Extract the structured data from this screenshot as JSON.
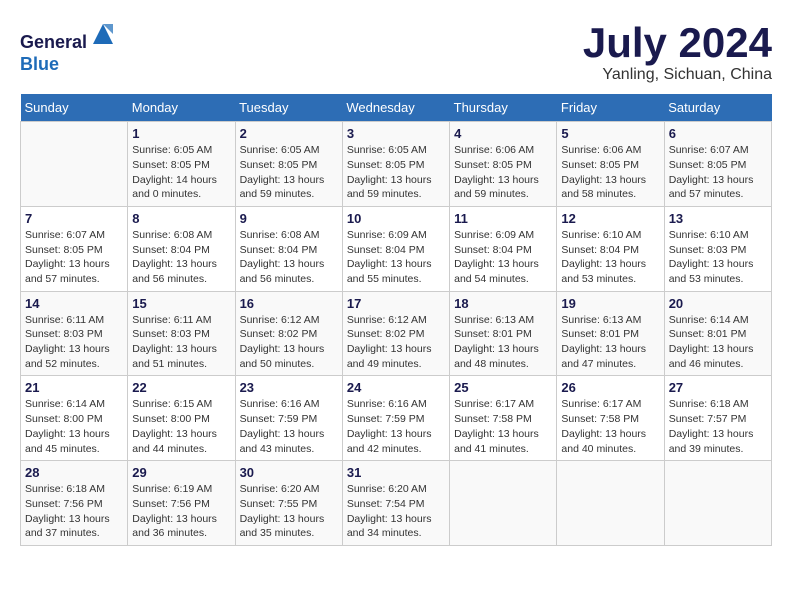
{
  "header": {
    "logo_line1": "General",
    "logo_line2": "Blue",
    "title": "July 2024",
    "location": "Yanling, Sichuan, China"
  },
  "calendar": {
    "weekdays": [
      "Sunday",
      "Monday",
      "Tuesday",
      "Wednesday",
      "Thursday",
      "Friday",
      "Saturday"
    ],
    "weeks": [
      [
        {
          "day": "",
          "info": ""
        },
        {
          "day": "1",
          "info": "Sunrise: 6:05 AM\nSunset: 8:05 PM\nDaylight: 14 hours\nand 0 minutes."
        },
        {
          "day": "2",
          "info": "Sunrise: 6:05 AM\nSunset: 8:05 PM\nDaylight: 13 hours\nand 59 minutes."
        },
        {
          "day": "3",
          "info": "Sunrise: 6:05 AM\nSunset: 8:05 PM\nDaylight: 13 hours\nand 59 minutes."
        },
        {
          "day": "4",
          "info": "Sunrise: 6:06 AM\nSunset: 8:05 PM\nDaylight: 13 hours\nand 59 minutes."
        },
        {
          "day": "5",
          "info": "Sunrise: 6:06 AM\nSunset: 8:05 PM\nDaylight: 13 hours\nand 58 minutes."
        },
        {
          "day": "6",
          "info": "Sunrise: 6:07 AM\nSunset: 8:05 PM\nDaylight: 13 hours\nand 57 minutes."
        }
      ],
      [
        {
          "day": "7",
          "info": "Sunrise: 6:07 AM\nSunset: 8:05 PM\nDaylight: 13 hours\nand 57 minutes."
        },
        {
          "day": "8",
          "info": "Sunrise: 6:08 AM\nSunset: 8:04 PM\nDaylight: 13 hours\nand 56 minutes."
        },
        {
          "day": "9",
          "info": "Sunrise: 6:08 AM\nSunset: 8:04 PM\nDaylight: 13 hours\nand 56 minutes."
        },
        {
          "day": "10",
          "info": "Sunrise: 6:09 AM\nSunset: 8:04 PM\nDaylight: 13 hours\nand 55 minutes."
        },
        {
          "day": "11",
          "info": "Sunrise: 6:09 AM\nSunset: 8:04 PM\nDaylight: 13 hours\nand 54 minutes."
        },
        {
          "day": "12",
          "info": "Sunrise: 6:10 AM\nSunset: 8:04 PM\nDaylight: 13 hours\nand 53 minutes."
        },
        {
          "day": "13",
          "info": "Sunrise: 6:10 AM\nSunset: 8:03 PM\nDaylight: 13 hours\nand 53 minutes."
        }
      ],
      [
        {
          "day": "14",
          "info": "Sunrise: 6:11 AM\nSunset: 8:03 PM\nDaylight: 13 hours\nand 52 minutes."
        },
        {
          "day": "15",
          "info": "Sunrise: 6:11 AM\nSunset: 8:03 PM\nDaylight: 13 hours\nand 51 minutes."
        },
        {
          "day": "16",
          "info": "Sunrise: 6:12 AM\nSunset: 8:02 PM\nDaylight: 13 hours\nand 50 minutes."
        },
        {
          "day": "17",
          "info": "Sunrise: 6:12 AM\nSunset: 8:02 PM\nDaylight: 13 hours\nand 49 minutes."
        },
        {
          "day": "18",
          "info": "Sunrise: 6:13 AM\nSunset: 8:01 PM\nDaylight: 13 hours\nand 48 minutes."
        },
        {
          "day": "19",
          "info": "Sunrise: 6:13 AM\nSunset: 8:01 PM\nDaylight: 13 hours\nand 47 minutes."
        },
        {
          "day": "20",
          "info": "Sunrise: 6:14 AM\nSunset: 8:01 PM\nDaylight: 13 hours\nand 46 minutes."
        }
      ],
      [
        {
          "day": "21",
          "info": "Sunrise: 6:14 AM\nSunset: 8:00 PM\nDaylight: 13 hours\nand 45 minutes."
        },
        {
          "day": "22",
          "info": "Sunrise: 6:15 AM\nSunset: 8:00 PM\nDaylight: 13 hours\nand 44 minutes."
        },
        {
          "day": "23",
          "info": "Sunrise: 6:16 AM\nSunset: 7:59 PM\nDaylight: 13 hours\nand 43 minutes."
        },
        {
          "day": "24",
          "info": "Sunrise: 6:16 AM\nSunset: 7:59 PM\nDaylight: 13 hours\nand 42 minutes."
        },
        {
          "day": "25",
          "info": "Sunrise: 6:17 AM\nSunset: 7:58 PM\nDaylight: 13 hours\nand 41 minutes."
        },
        {
          "day": "26",
          "info": "Sunrise: 6:17 AM\nSunset: 7:58 PM\nDaylight: 13 hours\nand 40 minutes."
        },
        {
          "day": "27",
          "info": "Sunrise: 6:18 AM\nSunset: 7:57 PM\nDaylight: 13 hours\nand 39 minutes."
        }
      ],
      [
        {
          "day": "28",
          "info": "Sunrise: 6:18 AM\nSunset: 7:56 PM\nDaylight: 13 hours\nand 37 minutes."
        },
        {
          "day": "29",
          "info": "Sunrise: 6:19 AM\nSunset: 7:56 PM\nDaylight: 13 hours\nand 36 minutes."
        },
        {
          "day": "30",
          "info": "Sunrise: 6:20 AM\nSunset: 7:55 PM\nDaylight: 13 hours\nand 35 minutes."
        },
        {
          "day": "31",
          "info": "Sunrise: 6:20 AM\nSunset: 7:54 PM\nDaylight: 13 hours\nand 34 minutes."
        },
        {
          "day": "",
          "info": ""
        },
        {
          "day": "",
          "info": ""
        },
        {
          "day": "",
          "info": ""
        }
      ]
    ]
  }
}
